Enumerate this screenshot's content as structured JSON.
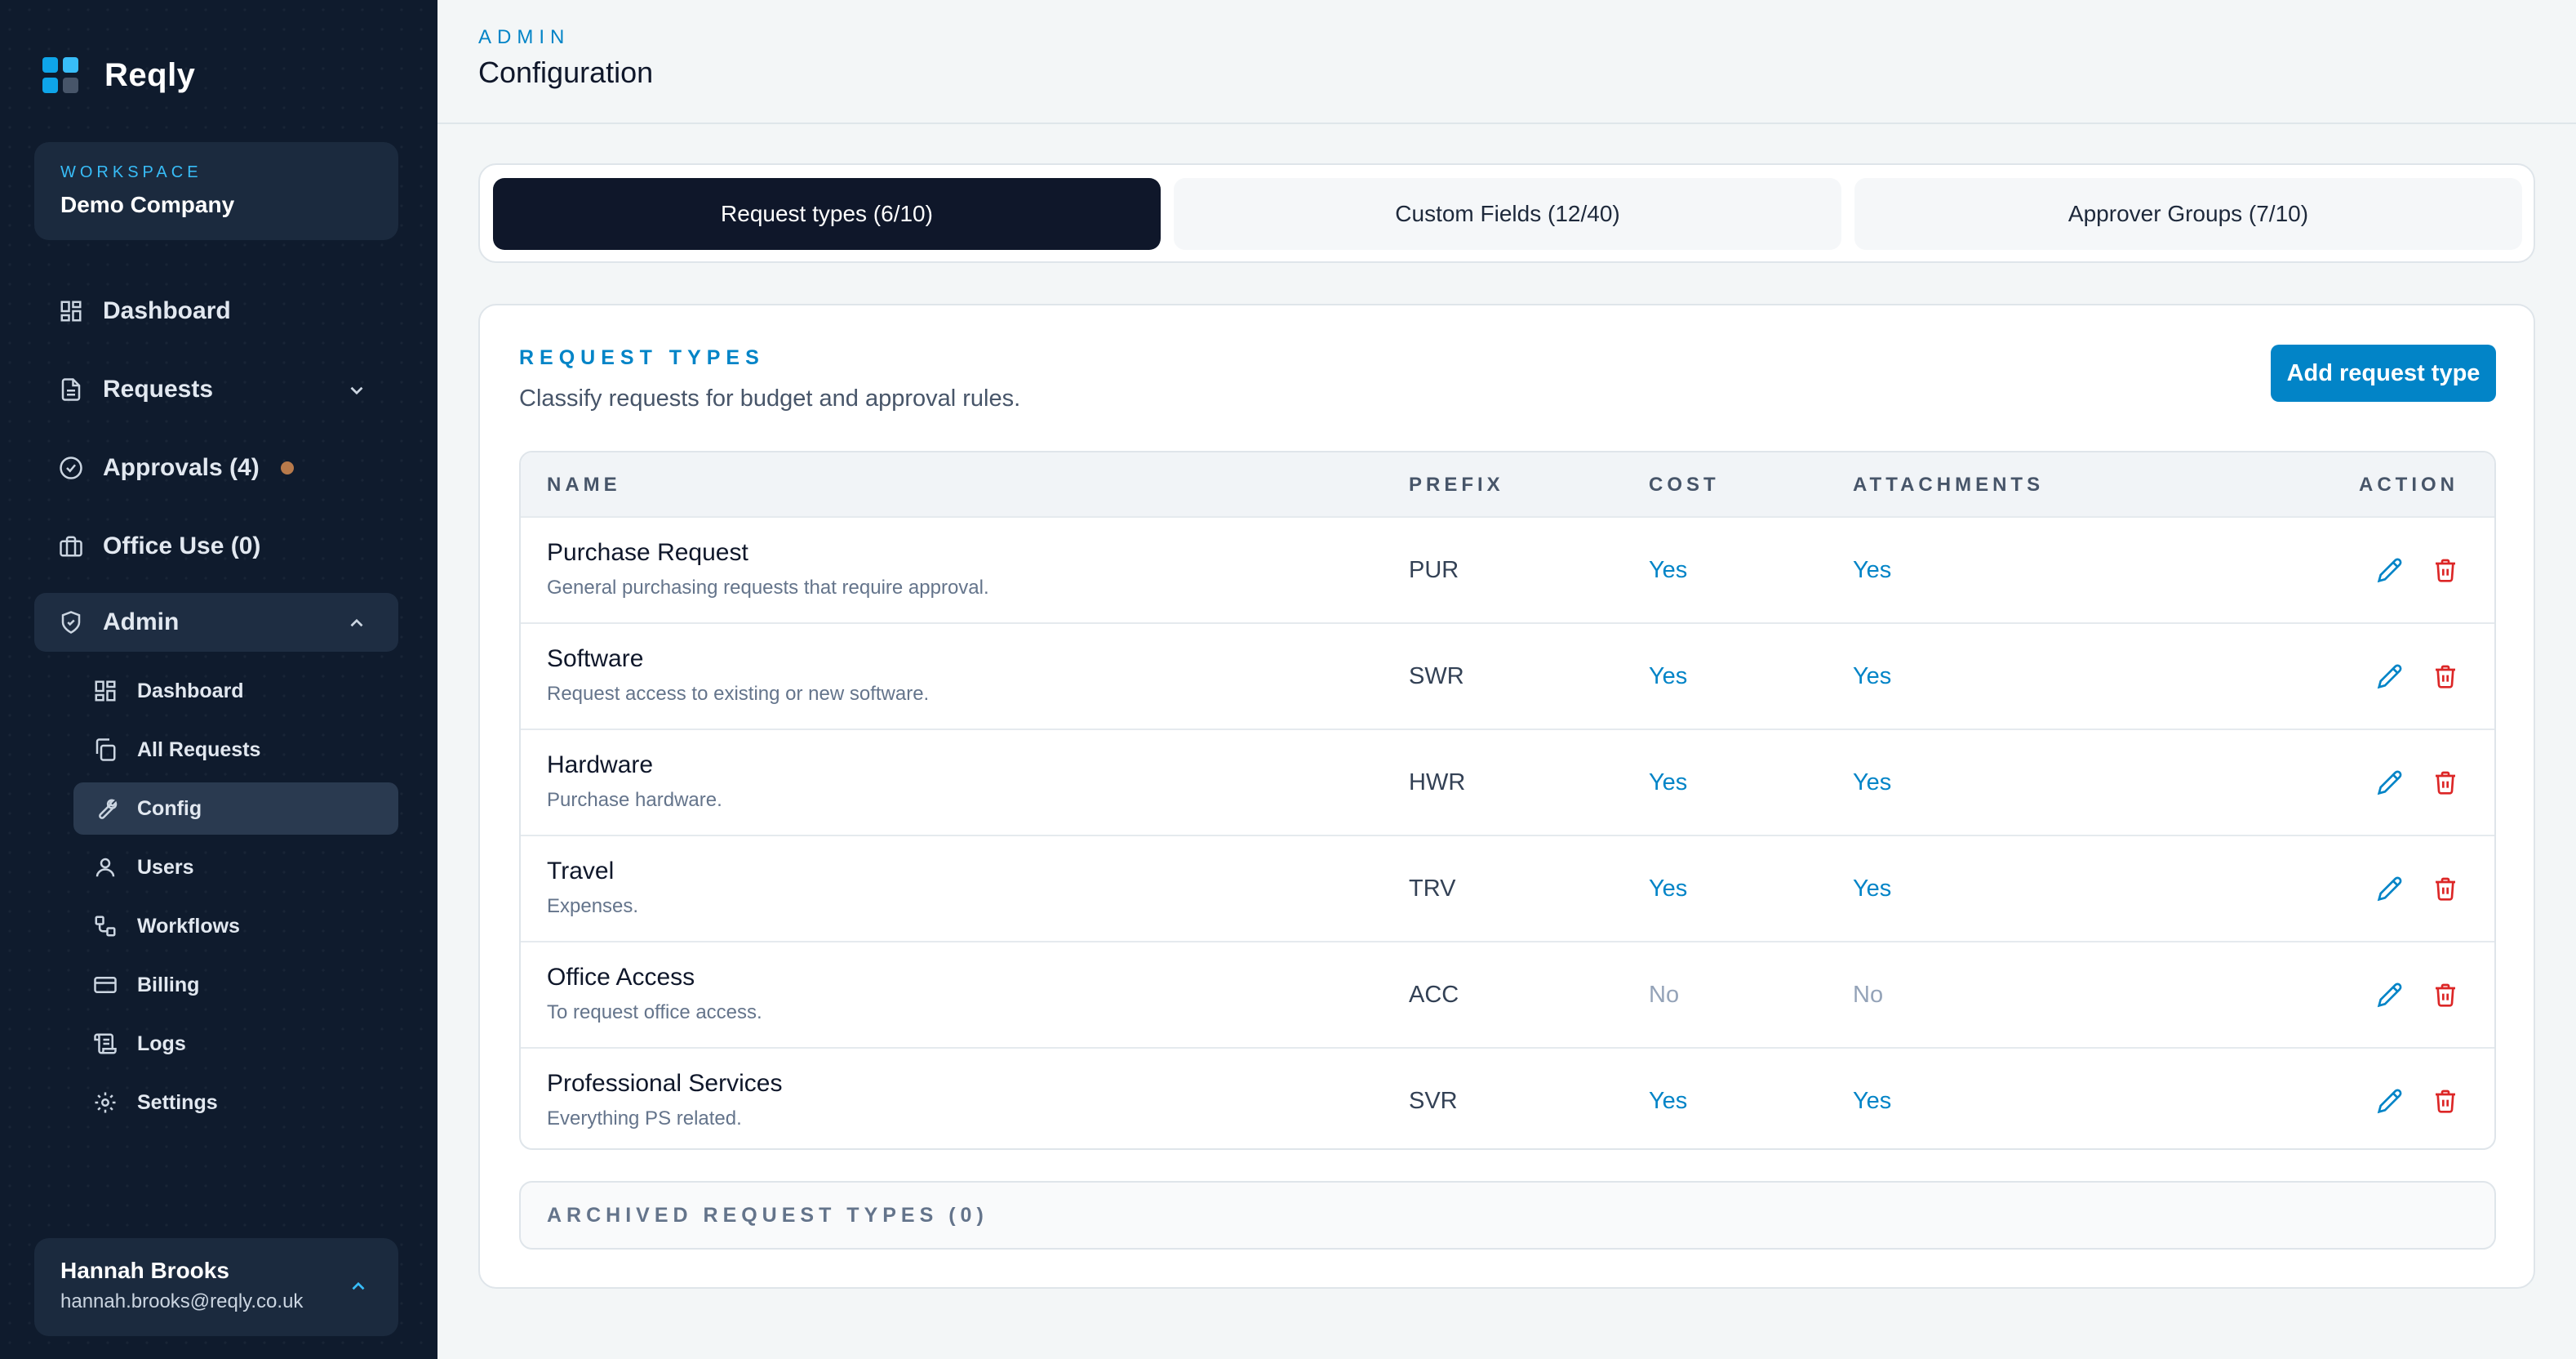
{
  "brand": {
    "name": "Reqly"
  },
  "workspace": {
    "label": "WORKSPACE",
    "name": "Demo Company"
  },
  "nav": {
    "dashboard": "Dashboard",
    "requests": "Requests",
    "approvals": "Approvals (4)",
    "office_use": "Office Use (0)",
    "admin": "Admin"
  },
  "admin_nav": [
    {
      "label": "Dashboard",
      "icon": "grid-icon"
    },
    {
      "label": "All Requests",
      "icon": "copy-icon"
    },
    {
      "label": "Config",
      "icon": "wrench-icon"
    },
    {
      "label": "Users",
      "icon": "user-icon"
    },
    {
      "label": "Workflows",
      "icon": "workflow-icon"
    },
    {
      "label": "Billing",
      "icon": "credit-card-icon"
    },
    {
      "label": "Logs",
      "icon": "scroll-icon"
    },
    {
      "label": "Settings",
      "icon": "gear-icon"
    }
  ],
  "user": {
    "name": "Hannah Brooks",
    "email": "hannah.brooks@reqly.co.uk"
  },
  "header": {
    "kicker": "ADMIN",
    "title": "Configuration"
  },
  "tabs": [
    {
      "label": "Request types (6/10)",
      "active": true
    },
    {
      "label": "Custom Fields (12/40)",
      "active": false
    },
    {
      "label": "Approver Groups (7/10)",
      "active": false
    }
  ],
  "section": {
    "title": "REQUEST TYPES",
    "description": "Classify requests for budget and approval rules.",
    "add_button": "Add request type"
  },
  "table": {
    "headers": {
      "name": "NAME",
      "prefix": "PREFIX",
      "cost": "COST",
      "attachments": "ATTACHMENTS",
      "action": "ACTION"
    },
    "rows": [
      {
        "name": "Purchase Request",
        "description": "General purchasing requests that require approval.",
        "prefix": "PUR",
        "cost": "Yes",
        "attachments": "Yes"
      },
      {
        "name": "Software",
        "description": "Request access to existing or new software.",
        "prefix": "SWR",
        "cost": "Yes",
        "attachments": "Yes"
      },
      {
        "name": "Hardware",
        "description": "Purchase hardware.",
        "prefix": "HWR",
        "cost": "Yes",
        "attachments": "Yes"
      },
      {
        "name": "Travel",
        "description": "Expenses.",
        "prefix": "TRV",
        "cost": "Yes",
        "attachments": "Yes"
      },
      {
        "name": "Office Access",
        "description": "To request office access.",
        "prefix": "ACC",
        "cost": "No",
        "attachments": "No"
      },
      {
        "name": "Professional Services",
        "description": "Everything PS related.",
        "prefix": "SVR",
        "cost": "Yes",
        "attachments": "Yes"
      }
    ]
  },
  "archived": {
    "label": "ARCHIVED REQUEST TYPES (0)"
  },
  "colors": {
    "sidebar_bg": "#0f1b2d",
    "accent": "#0284c7",
    "danger": "#dc2626",
    "notification_dot": "#b87a4b"
  }
}
